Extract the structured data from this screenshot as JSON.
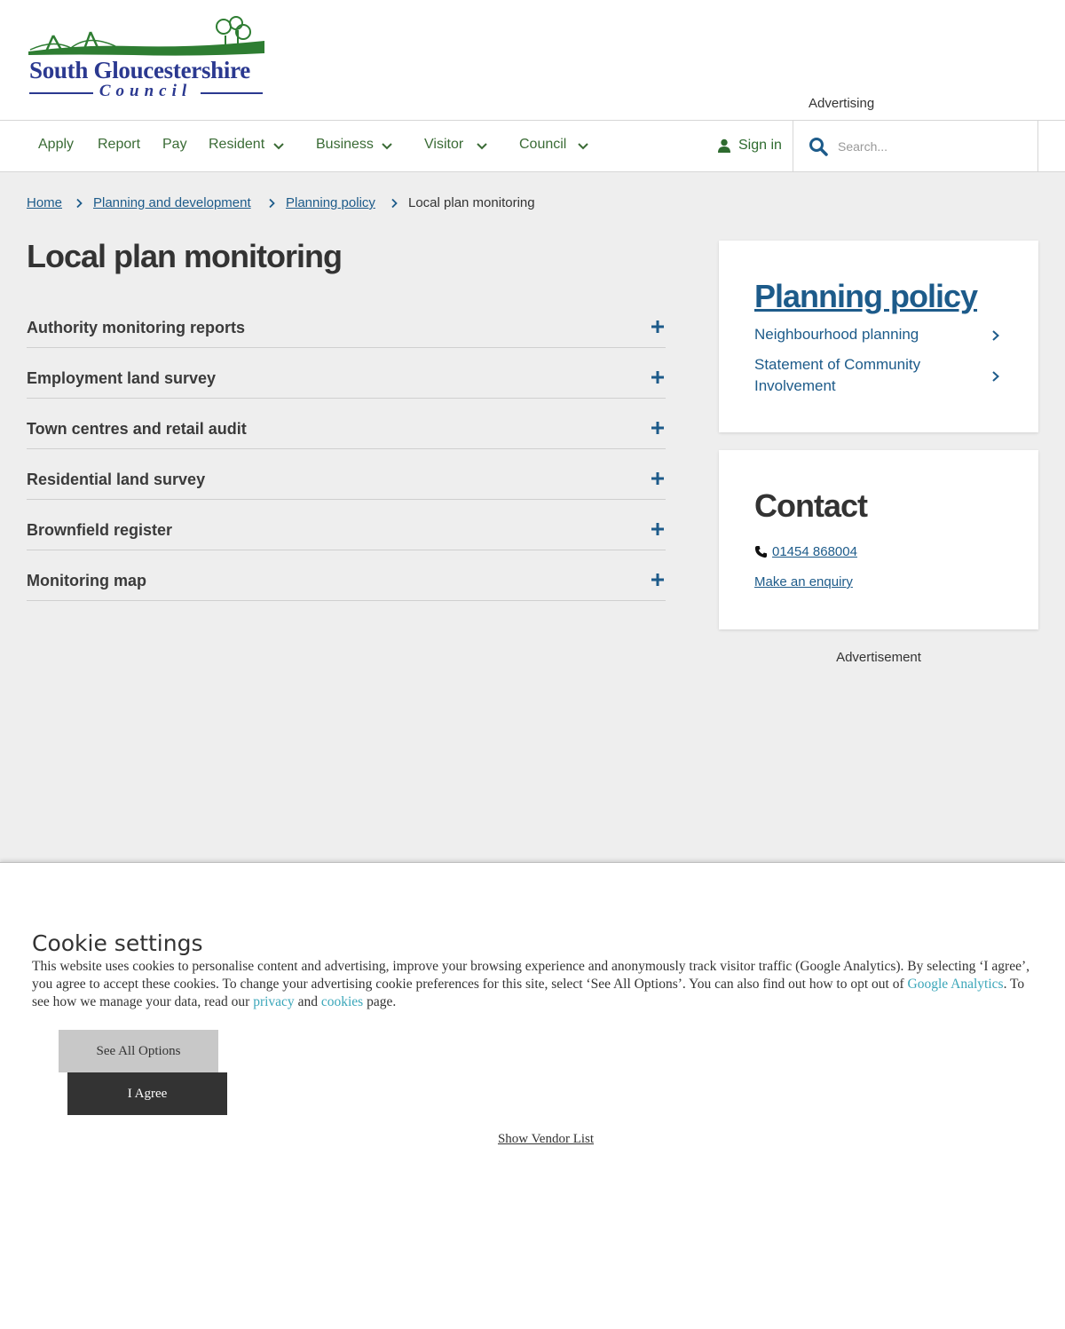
{
  "header": {
    "logo_title": "South Gloucestershire",
    "logo_subtitle": "Council",
    "advertising_label": "Advertising"
  },
  "nav": {
    "items": [
      "Apply",
      "Report",
      "Pay",
      "Resident",
      "Business",
      "Visitor",
      "Council"
    ],
    "sign_in": "Sign in",
    "search_placeholder": "Search..."
  },
  "breadcrumb": {
    "items": [
      "Home",
      "Planning and development",
      "Planning policy"
    ],
    "current": "Local plan monitoring"
  },
  "page": {
    "title": "Local plan monitoring",
    "accordion": [
      "Authority monitoring reports",
      "Employment land survey",
      "Town centres and retail audit",
      "Residential land survey",
      "Brownfield register",
      "Monitoring map"
    ]
  },
  "sidebar": {
    "policy_heading": "Planning policy",
    "policy_links": [
      "Neighbourhood planning",
      "Statement of Community Involvement"
    ],
    "contact_heading": "Contact",
    "phone": "01454 868004",
    "enquiry": "Make an enquiry",
    "advertisement": "Advertisement"
  },
  "cookie": {
    "title": "Cookie settings",
    "text_1": "This website uses cookies to personalise content and advertising, improve your browsing experience and anonymously track visitor traffic (Google Analytics). By selecting ‘I agree’, you agree to accept these cookies. To change your advertising cookie preferences for this site, select ‘See All Options’. You can also find out how to opt out of ",
    "link_analytics": "Google Analytics",
    "text_2": ". To see how we manage your data, read our ",
    "link_privacy": "privacy",
    "text_3": " and ",
    "link_cookies": "cookies",
    "text_4": " page.",
    "see_all_options": "See All Options",
    "agree": "I Agree",
    "vendor_list": "Show Vendor List"
  },
  "colors": {
    "nav_green": "#3a6b35",
    "link_blue": "#1d5b8a",
    "logo_blue": "#2b3990",
    "logo_green": "#2e7d32",
    "cookie_link": "#3aa6b9"
  }
}
